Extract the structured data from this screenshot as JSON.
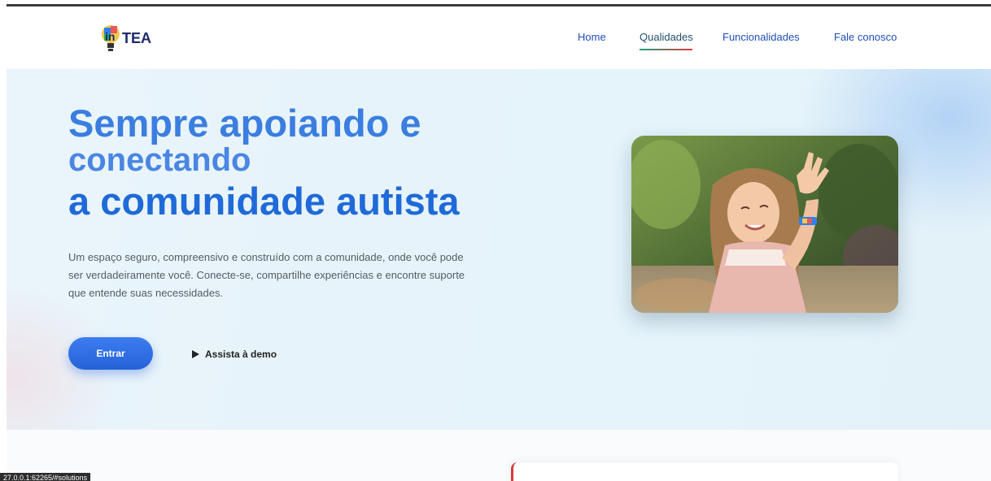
{
  "brand": {
    "logo_text": "TEA",
    "logo_prefix": "in"
  },
  "nav": {
    "items": [
      {
        "label": "Home"
      },
      {
        "label": "Qualidades"
      },
      {
        "label": "Funcionalidades"
      },
      {
        "label": "Fale conosco"
      }
    ],
    "active": "Qualidades"
  },
  "hero": {
    "title_line1": "Sempre apoiando e",
    "title_line2": "conectando",
    "title_line3": "a comunidade autista",
    "description": "Um espaço seguro, compreensivo e construído com a comunidade, onde você pode ser verdadeiramente você. Conecte-se, compartilhe experiências e encontre suporte que entende suas necessidades.",
    "primary_button": "Entrar",
    "demo_button": "Assista à demo",
    "photo_icon": "photo-girl-waving"
  },
  "status_bar": {
    "url": "27.0.0.1:62265/#solutions"
  },
  "colors": {
    "primary": "#2461d8",
    "title": "#3b7ee0",
    "nav_link": "#1e4fb4"
  }
}
